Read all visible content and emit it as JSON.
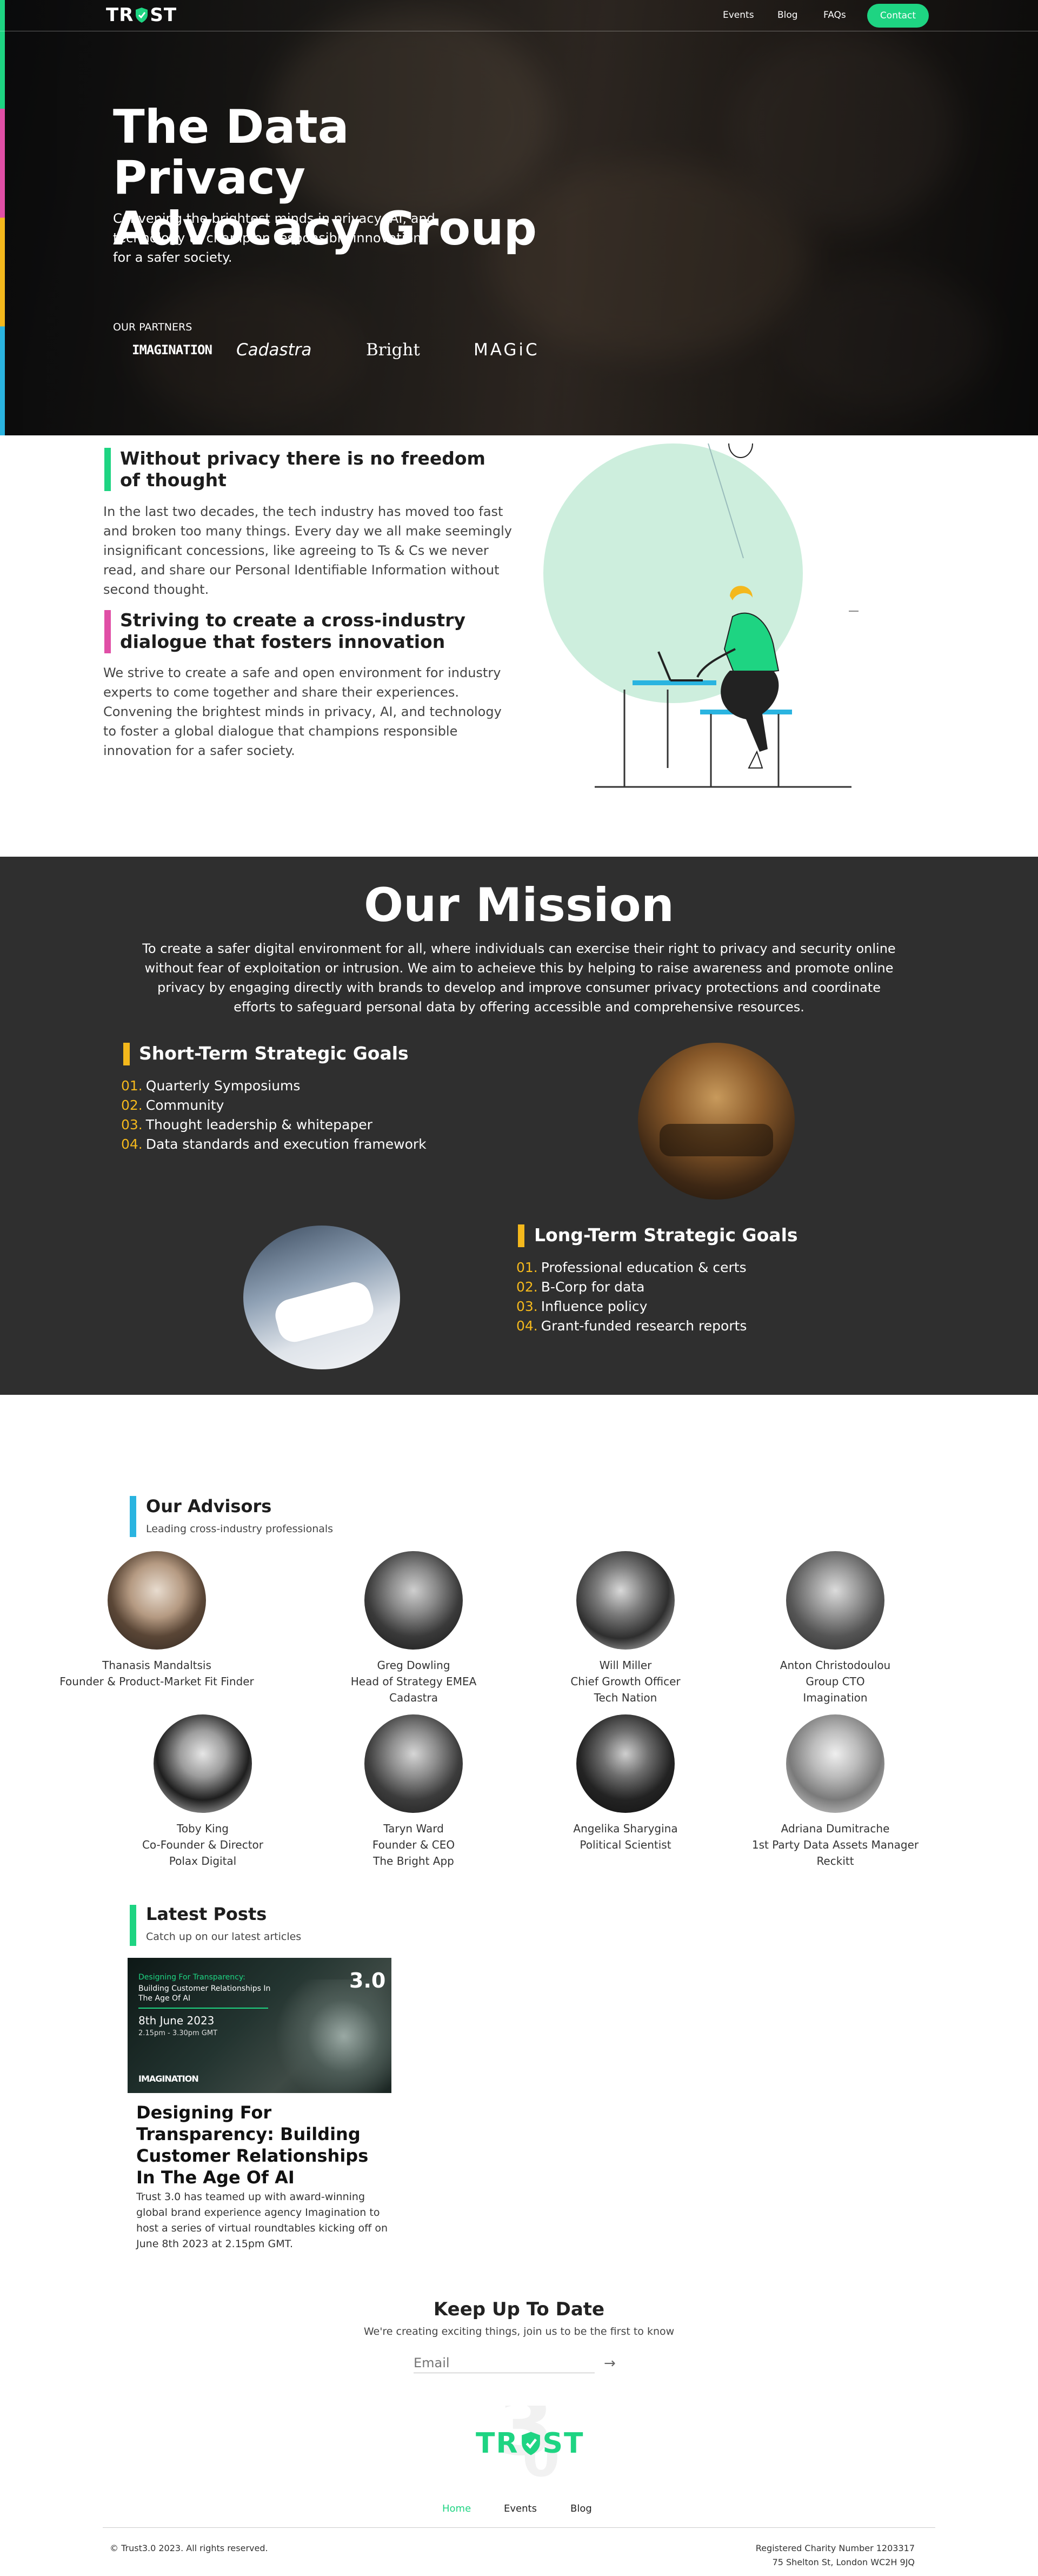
{
  "nav": {
    "logo": "TRST",
    "links": [
      "Events",
      "Blog",
      "FAQs"
    ],
    "contact": "Contact"
  },
  "hero": {
    "title": "The Data Privacy Advocacy Group",
    "subtitle": "Convening the brightest minds in privacy, AI, and technology to champion responsible innovation for a safer society.",
    "partners_label": "OUR PARTNERS",
    "partners": [
      "IMAGINATION",
      "Cadastra",
      "Bright",
      "MAGiC"
    ]
  },
  "privacy": {
    "heading1": "Without privacy there is no freedom of thought",
    "para1": "In the last two decades, the tech industry has moved too fast and broken too many things. Every day we all make seemingly insignificant concessions, like agreeing to Ts & Cs we never read, and share our Personal Identifiable Information without second thought.",
    "heading2": "Striving to create a cross-industry dialogue that fosters innovation",
    "para2": "We strive to create a safe and open environment for industry experts to come together and share their experiences. Convening the brightest minds in privacy, AI, and technology to foster a global dialogue that champions responsible innovation for a safer society."
  },
  "mission": {
    "title": "Our Mission",
    "text": "To create a safer digital environment for all, where individuals can exercise their right to privacy and security online without fear of exploitation or intrusion. We aim to acheieve this by helping to raise awareness and promote online privacy by engaging directly with brands to develop and improve consumer privacy protections and coordinate efforts to safeguard personal data by offering accessible and comprehensive resources.",
    "short_title": "Short-Term Strategic Goals",
    "short_goals": [
      {
        "n": "01.",
        "t": "Quarterly Symposiums"
      },
      {
        "n": "02.",
        "t": "Community"
      },
      {
        "n": "03.",
        "t": "Thought leadership & whitepaper"
      },
      {
        "n": "04.",
        "t": "Data standards and execution framework"
      }
    ],
    "long_title": "Long-Term Strategic Goals",
    "long_goals": [
      {
        "n": "01.",
        "t": "Professional education & certs"
      },
      {
        "n": "02.",
        "t": "B-Corp for data"
      },
      {
        "n": "03.",
        "t": "Influence policy"
      },
      {
        "n": "04.",
        "t": "Grant-funded research reports"
      }
    ]
  },
  "advisors": {
    "title": "Our Advisors",
    "subtitle": "Leading cross-industry professionals",
    "people": [
      {
        "name": "Thanasis Mandaltsis",
        "role": "Founder & Product-Market Fit Finder",
        "org": ""
      },
      {
        "name": "Greg Dowling",
        "role": "Head of Strategy EMEA",
        "org": "Cadastra"
      },
      {
        "name": "Will Miller",
        "role": "Chief Growth Officer",
        "org": "Tech Nation"
      },
      {
        "name": "Anton Christodoulou",
        "role": "Group CTO",
        "org": "Imagination"
      },
      {
        "name": "Toby King",
        "role": "Co-Founder & Director",
        "org": "Polax Digital"
      },
      {
        "name": "Taryn Ward",
        "role": "Founder & CEO",
        "org": "The Bright App"
      },
      {
        "name": "Angelika Sharygina",
        "role": "Political Scientist",
        "org": ""
      },
      {
        "name": "Adriana Dumitrache",
        "role": "1st Party Data Assets Manager",
        "org": "Reckitt"
      }
    ]
  },
  "posts": {
    "title": "Latest Posts",
    "subtitle": "Catch up on our latest articles",
    "card": {
      "banner_title": "Designing For Transparency:",
      "banner_sub": "Building Customer Relationships In The Age Of AI",
      "date": "8th June 2023",
      "time": "2.15pm - 3.30pm GMT",
      "badge": "3.0",
      "brand": "IMAGINATION",
      "title": "Designing For Transparency: Building Customer Relationships In The Age Of AI",
      "desc": "Trust 3.0 has teamed up with award-winning global brand experience agency Imagination to host a series of virtual roundtables kicking off on June 8th 2023 at 2.15pm GMT."
    }
  },
  "newsletter": {
    "title": "Keep Up To Date",
    "subtitle": "We're creating exciting things, join us to be the first to know",
    "placeholder": "Email",
    "arrow": "→"
  },
  "footer": {
    "logo": "TRST",
    "links": [
      "Home",
      "Events",
      "Blog"
    ],
    "copyright": "© Trust3.0 2023. All rights reserved.",
    "charity": "Registered Charity Number 1203317",
    "address": "75 Shelton St, London WC2H 9JQ"
  },
  "colors": {
    "green": "#1ed482",
    "pink": "#e04fa6",
    "yellow": "#f4b81c",
    "blue": "#2ab4e0",
    "dark": "#2f2f2f"
  }
}
